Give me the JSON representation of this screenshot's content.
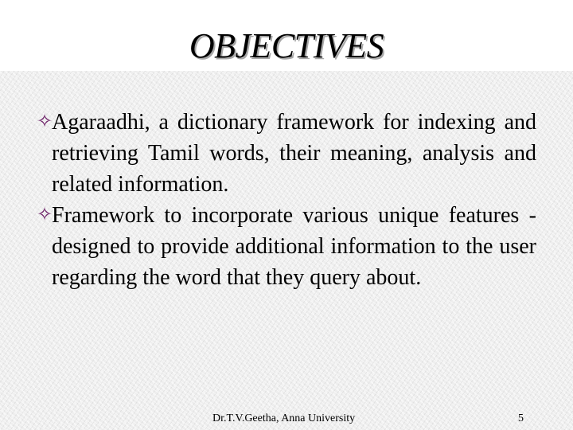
{
  "slide": {
    "title": "OBJECTIVES",
    "bullets": [
      {
        "icon": "four-point-star-outline-icon",
        "text": "Agaraadhi, a dictionary framework for indexing and retrieving Tamil words, their meaning, analysis and related information."
      },
      {
        "icon": "four-point-star-outline-icon",
        "text": "Framework to incorporate various unique features - designed to provide additional information to the user regarding the word that they query about."
      }
    ],
    "bullet_glyph": "✧",
    "bullet_color": "#6b1f66",
    "footer": {
      "author": "Dr.T.V.Geetha, Anna University",
      "page_number": "5"
    }
  }
}
